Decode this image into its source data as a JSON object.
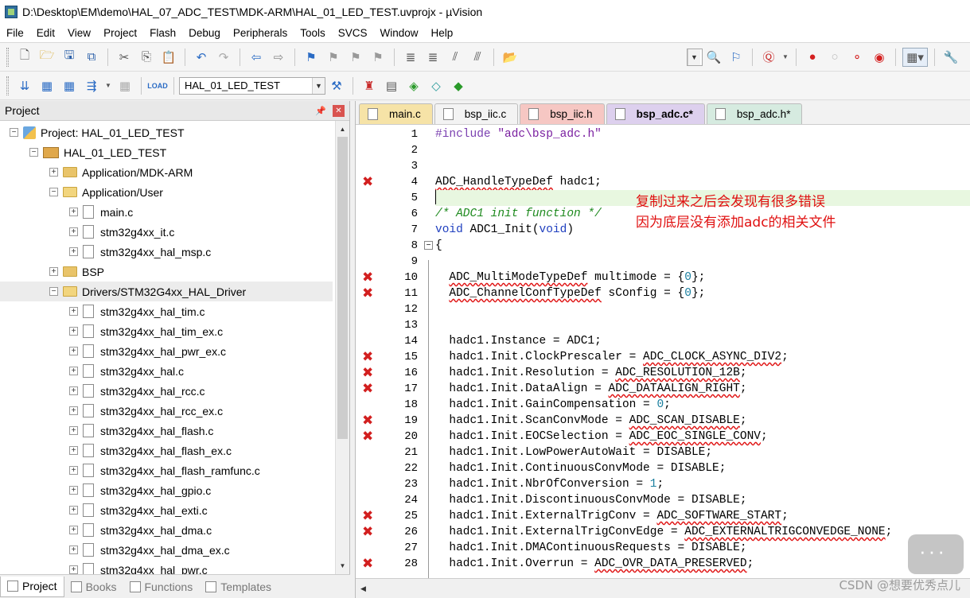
{
  "window": {
    "title": "D:\\Desktop\\EM\\demo\\HAL_07_ADC_TEST\\MDK-ARM\\HAL_01_LED_TEST.uvprojx - µVision"
  },
  "menu": [
    "File",
    "Edit",
    "View",
    "Project",
    "Flash",
    "Debug",
    "Peripherals",
    "Tools",
    "SVCS",
    "Window",
    "Help"
  ],
  "toolbar2": {
    "target": "HAL_01_LED_TEST"
  },
  "project_panel": {
    "title": "Project",
    "tree": [
      {
        "label": "Project: HAL_01_LED_TEST",
        "level": 0,
        "kind": "project",
        "expanded": true
      },
      {
        "label": "HAL_01_LED_TEST",
        "level": 1,
        "kind": "target",
        "expanded": true
      },
      {
        "label": "Application/MDK-ARM",
        "level": 2,
        "kind": "folder",
        "expanded": false
      },
      {
        "label": "Application/User",
        "level": 2,
        "kind": "folder",
        "expanded": true
      },
      {
        "label": "main.c",
        "level": 3,
        "kind": "file"
      },
      {
        "label": "stm32g4xx_it.c",
        "level": 3,
        "kind": "file"
      },
      {
        "label": "stm32g4xx_hal_msp.c",
        "level": 3,
        "kind": "file"
      },
      {
        "label": "BSP",
        "level": 2,
        "kind": "folder",
        "expanded": false
      },
      {
        "label": "Drivers/STM32G4xx_HAL_Driver",
        "level": 2,
        "kind": "folder",
        "expanded": true,
        "selected": true
      },
      {
        "label": "stm32g4xx_hal_tim.c",
        "level": 3,
        "kind": "file"
      },
      {
        "label": "stm32g4xx_hal_tim_ex.c",
        "level": 3,
        "kind": "file"
      },
      {
        "label": "stm32g4xx_hal_pwr_ex.c",
        "level": 3,
        "kind": "file"
      },
      {
        "label": "stm32g4xx_hal.c",
        "level": 3,
        "kind": "file"
      },
      {
        "label": "stm32g4xx_hal_rcc.c",
        "level": 3,
        "kind": "file"
      },
      {
        "label": "stm32g4xx_hal_rcc_ex.c",
        "level": 3,
        "kind": "file"
      },
      {
        "label": "stm32g4xx_hal_flash.c",
        "level": 3,
        "kind": "file"
      },
      {
        "label": "stm32g4xx_hal_flash_ex.c",
        "level": 3,
        "kind": "file"
      },
      {
        "label": "stm32g4xx_hal_flash_ramfunc.c",
        "level": 3,
        "kind": "file"
      },
      {
        "label": "stm32g4xx_hal_gpio.c",
        "level": 3,
        "kind": "file"
      },
      {
        "label": "stm32g4xx_hal_exti.c",
        "level": 3,
        "kind": "file"
      },
      {
        "label": "stm32g4xx_hal_dma.c",
        "level": 3,
        "kind": "file"
      },
      {
        "label": "stm32g4xx_hal_dma_ex.c",
        "level": 3,
        "kind": "file"
      },
      {
        "label": "stm32g4xx_hal_pwr.c",
        "level": 3,
        "kind": "file"
      }
    ],
    "bottom_tabs": [
      {
        "label": "Project",
        "active": true
      },
      {
        "label": "Books",
        "active": false
      },
      {
        "label": "Functions",
        "active": false
      },
      {
        "label": "Templates",
        "active": false
      }
    ]
  },
  "editor": {
    "tabs": [
      {
        "label": "main.c",
        "color": "#f6e3a7",
        "active": false
      },
      {
        "label": "bsp_iic.c",
        "color": "#f3f3f3",
        "active": false
      },
      {
        "label": "bsp_iic.h",
        "color": "#f6c7c3",
        "active": false
      },
      {
        "label": "bsp_adc.c*",
        "color": "#ddd0ee",
        "active": true
      },
      {
        "label": "bsp_adc.h*",
        "color": "#d6ebe0",
        "active": false
      }
    ],
    "lines": [
      {
        "n": "1",
        "err": false,
        "segs": [
          [
            "pp",
            "#include "
          ],
          [
            "st",
            "\"adc\\bsp_adc.h\""
          ]
        ]
      },
      {
        "n": "2",
        "err": false,
        "segs": []
      },
      {
        "n": "3",
        "err": false,
        "segs": []
      },
      {
        "n": "4",
        "err": true,
        "segs": [
          [
            "err",
            "ADC_HandleTypeDef"
          ],
          [
            "",
            " hadc1;"
          ]
        ]
      },
      {
        "n": "5",
        "err": false,
        "current": true,
        "segs": []
      },
      {
        "n": "6",
        "err": false,
        "segs": [
          [
            "cm",
            "/* ADC1 init function */"
          ]
        ]
      },
      {
        "n": "7",
        "err": false,
        "segs": [
          [
            "kw",
            "void"
          ],
          [
            "",
            " ADC1_Init("
          ],
          [
            "kw",
            "void"
          ],
          [
            "",
            ")"
          ]
        ]
      },
      {
        "n": "8",
        "err": false,
        "fold": true,
        "segs": [
          [
            "",
            "{"
          ]
        ]
      },
      {
        "n": "9",
        "err": false,
        "segs": []
      },
      {
        "n": "10",
        "err": true,
        "segs": [
          [
            "",
            "  "
          ],
          [
            "err",
            "ADC_MultiModeTypeDef"
          ],
          [
            "",
            " multimode = {"
          ],
          [
            "num",
            "0"
          ],
          [
            "",
            "};"
          ]
        ]
      },
      {
        "n": "11",
        "err": true,
        "segs": [
          [
            "",
            "  "
          ],
          [
            "err",
            "ADC_ChannelConfTypeDef"
          ],
          [
            "",
            " sConfig = {"
          ],
          [
            "num",
            "0"
          ],
          [
            "",
            "};"
          ]
        ]
      },
      {
        "n": "12",
        "err": false,
        "segs": []
      },
      {
        "n": "13",
        "err": false,
        "segs": []
      },
      {
        "n": "14",
        "err": false,
        "segs": [
          [
            "",
            "  hadc1.Instance = ADC1;"
          ]
        ]
      },
      {
        "n": "15",
        "err": true,
        "segs": [
          [
            "",
            "  hadc1.Init.ClockPrescaler = "
          ],
          [
            "err",
            "ADC_CLOCK_ASYNC_DIV2"
          ],
          [
            "",
            ";"
          ]
        ]
      },
      {
        "n": "16",
        "err": true,
        "segs": [
          [
            "",
            "  hadc1.Init.Resolution = "
          ],
          [
            "err",
            "ADC_RESOLUTION_12B"
          ],
          [
            "",
            ";"
          ]
        ]
      },
      {
        "n": "17",
        "err": true,
        "segs": [
          [
            "",
            "  hadc1.Init.DataAlign = "
          ],
          [
            "err",
            "ADC_DATAALIGN_RIGHT"
          ],
          [
            "",
            ";"
          ]
        ]
      },
      {
        "n": "18",
        "err": false,
        "segs": [
          [
            "",
            "  hadc1.Init.GainCompensation = "
          ],
          [
            "num",
            "0"
          ],
          [
            "",
            ";"
          ]
        ]
      },
      {
        "n": "19",
        "err": true,
        "segs": [
          [
            "",
            "  hadc1.Init.ScanConvMode = "
          ],
          [
            "err",
            "ADC_SCAN_DISABLE"
          ],
          [
            "",
            ";"
          ]
        ]
      },
      {
        "n": "20",
        "err": true,
        "segs": [
          [
            "",
            "  hadc1.Init.EOCSelection = "
          ],
          [
            "err",
            "ADC_EOC_SINGLE_CONV"
          ],
          [
            "",
            ";"
          ]
        ]
      },
      {
        "n": "21",
        "err": false,
        "segs": [
          [
            "",
            "  hadc1.Init.LowPowerAutoWait = DISABLE;"
          ]
        ]
      },
      {
        "n": "22",
        "err": false,
        "segs": [
          [
            "",
            "  hadc1.Init.ContinuousConvMode = DISABLE;"
          ]
        ]
      },
      {
        "n": "23",
        "err": false,
        "segs": [
          [
            "",
            "  hadc1.Init.NbrOfConversion = "
          ],
          [
            "num",
            "1"
          ],
          [
            "",
            ";"
          ]
        ]
      },
      {
        "n": "24",
        "err": false,
        "segs": [
          [
            "",
            "  hadc1.Init.DiscontinuousConvMode = DISABLE;"
          ]
        ]
      },
      {
        "n": "25",
        "err": true,
        "segs": [
          [
            "",
            "  hadc1.Init.ExternalTrigConv = "
          ],
          [
            "err",
            "ADC_SOFTWARE_START"
          ],
          [
            "",
            ";"
          ]
        ]
      },
      {
        "n": "26",
        "err": true,
        "segs": [
          [
            "",
            "  hadc1.Init.ExternalTrigConvEdge = "
          ],
          [
            "err",
            "ADC_EXTERNALTRIGCONVEDGE_NONE"
          ],
          [
            "",
            ";"
          ]
        ]
      },
      {
        "n": "27",
        "err": false,
        "segs": [
          [
            "",
            "  hadc1.Init.DMAContinuousRequests = DISABLE;"
          ]
        ]
      },
      {
        "n": "28",
        "err": true,
        "segs": [
          [
            "",
            "  hadc1.Init.Overrun = "
          ],
          [
            "err",
            "ADC_OVR_DATA_PRESERVED"
          ],
          [
            "",
            ";"
          ]
        ]
      }
    ],
    "annotation": [
      "复制过来之后会发现有很多错误",
      "因为底层没有添加adc的相关文件"
    ]
  },
  "watermark": "CSDN @想要优秀点儿"
}
